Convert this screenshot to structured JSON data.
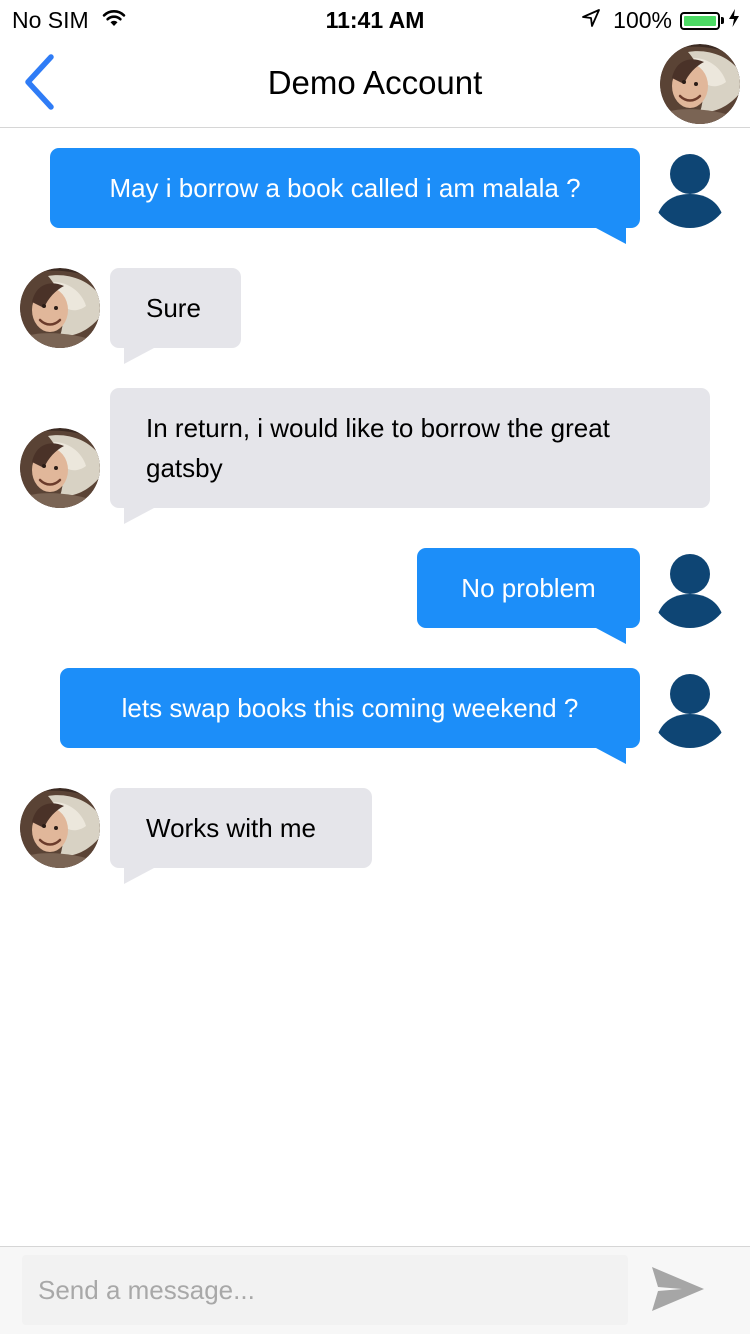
{
  "status_bar": {
    "carrier": "No SIM",
    "time": "11:41 AM",
    "battery": "100%",
    "battery_level": 1.0
  },
  "nav": {
    "title": "Demo Account",
    "back_icon": "chevron-left-icon",
    "accent_color": "#2f7cf6"
  },
  "messages": [
    {
      "direction": "out",
      "text": "May i borrow a book called i am malala ?"
    },
    {
      "direction": "in",
      "text": "Sure"
    },
    {
      "direction": "in",
      "text": "In return, i would like to borrow the great gatsby"
    },
    {
      "direction": "out",
      "text": "No problem"
    },
    {
      "direction": "out",
      "text": "lets swap books this coming weekend ?"
    },
    {
      "direction": "in",
      "text": "Works with me"
    }
  ],
  "composer": {
    "placeholder": "Send a message...",
    "send_icon": "send-icon"
  },
  "colors": {
    "outgoing_bubble": "#1c8ef9",
    "incoming_bubble": "#e5e5ea",
    "user_avatar": "#0e4574",
    "battery_fill": "#4cd964"
  }
}
